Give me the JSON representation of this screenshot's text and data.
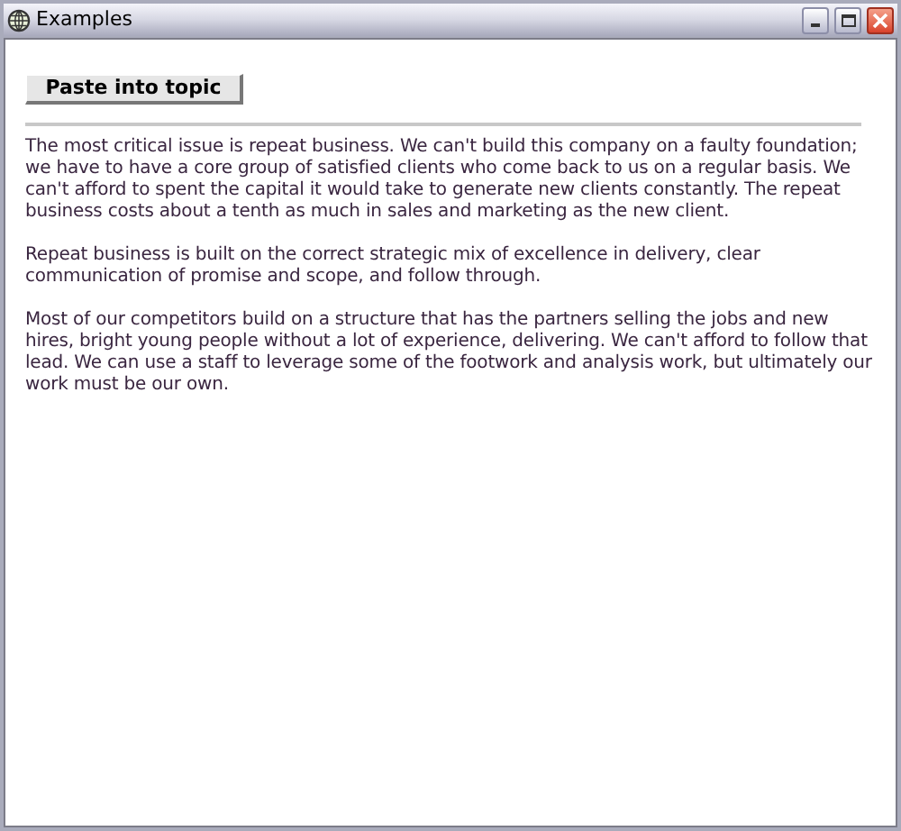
{
  "window": {
    "title": "Examples"
  },
  "toolbar": {
    "button": "Paste into topic"
  },
  "paragraphs": [
    "The most critical issue is repeat business. We can't build this company on a faulty foundation; we have to have a core group of satisfied clients who come back to us on a regular basis. We can't afford to spent the capital it would take to generate new clients constantly. The repeat business costs about a tenth as much in sales and marketing as the new client.",
    "Repeat business is built on the correct strategic mix of excellence in delivery, clear communication of promise and scope, and follow through.",
    "Most of our competitors build on a structure that has the partners selling the jobs and new hires, bright young people without a lot of experience, delivering. We can't afford to follow that lead. We can use a staff to leverage some of the footwork and analysis work, but ultimately our work must be our own."
  ]
}
